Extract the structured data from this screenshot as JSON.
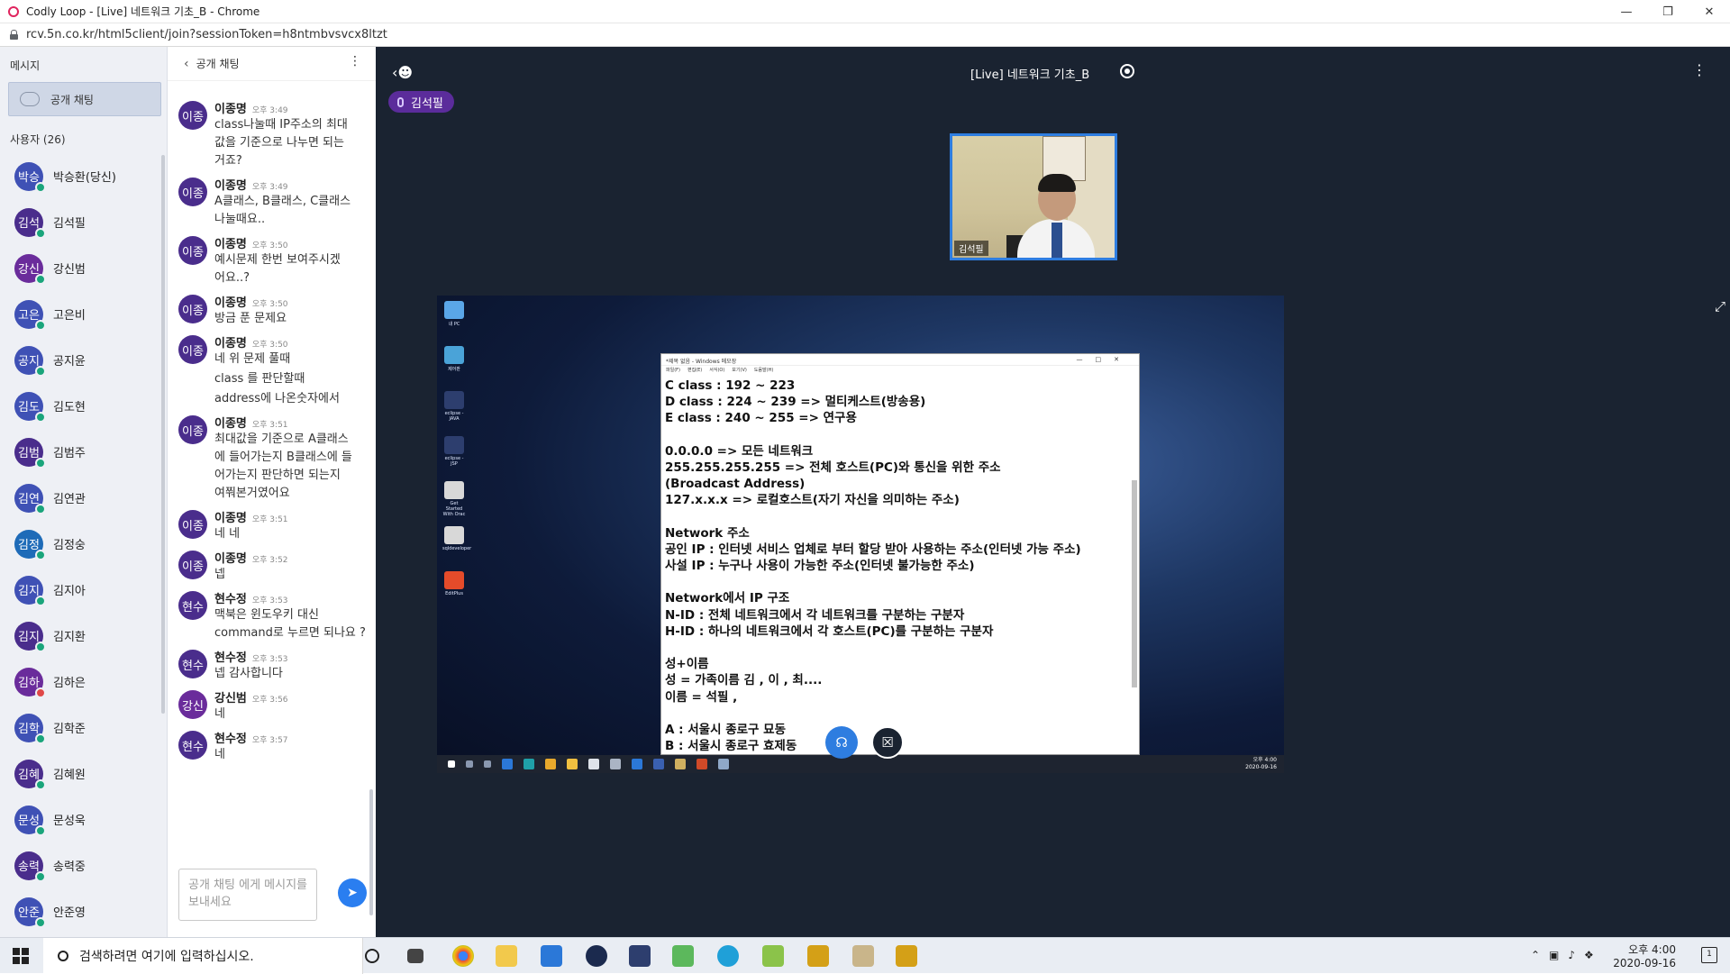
{
  "browser": {
    "title": "Codly Loop - [Live] 네트워크 기초_B - Chrome",
    "url": "rcv.5n.co.kr/html5client/join?sessionToken=h8ntmbvsvcx8ltzt"
  },
  "sidebar": {
    "messages_header": "메시지",
    "public_chat_label": "공개 채팅",
    "users_header": "사용자 (26)",
    "users": [
      {
        "initials": "박승",
        "name": "박승환(당신)",
        "color": "#3f51b5",
        "status": "ok"
      },
      {
        "initials": "김석",
        "name": "김석필",
        "color": "#4a2d8c",
        "status": "ok"
      },
      {
        "initials": "강신",
        "name": "강신범",
        "color": "#6a2c9b",
        "status": "ok"
      },
      {
        "initials": "고은",
        "name": "고은비",
        "color": "#3f51b5",
        "status": "ok"
      },
      {
        "initials": "공지",
        "name": "공지윤",
        "color": "#3f51b5",
        "status": "ok"
      },
      {
        "initials": "김도",
        "name": "김도현",
        "color": "#3f51b5",
        "status": "ok"
      },
      {
        "initials": "김범",
        "name": "김범주",
        "color": "#4a2d8c",
        "status": "ok"
      },
      {
        "initials": "김연",
        "name": "김연관",
        "color": "#3f51b5",
        "status": "ok"
      },
      {
        "initials": "김정",
        "name": "김정숭",
        "color": "#1e6bb8",
        "status": "ok"
      },
      {
        "initials": "김지",
        "name": "김지아",
        "color": "#3f51b5",
        "status": "ok"
      },
      {
        "initials": "김지",
        "name": "김지환",
        "color": "#4a2d8c",
        "status": "ok"
      },
      {
        "initials": "김하",
        "name": "김하은",
        "color": "#6a2c9b",
        "status": "muted"
      },
      {
        "initials": "김학",
        "name": "김학준",
        "color": "#3f51b5",
        "status": "ok"
      },
      {
        "initials": "김혜",
        "name": "김혜원",
        "color": "#4a2d8c",
        "status": "ok"
      },
      {
        "initials": "문성",
        "name": "문성욱",
        "color": "#3f51b5",
        "status": "ok"
      },
      {
        "initials": "송력",
        "name": "송력중",
        "color": "#4a2d8c",
        "status": "ok"
      },
      {
        "initials": "안준",
        "name": "안준영",
        "color": "#3f51b5",
        "status": "ok"
      }
    ]
  },
  "chat": {
    "title": "공개 채팅",
    "input_placeholder": "공개 채팅 에게 메시지를 보내세요",
    "messages": [
      {
        "initials": "이종",
        "author": "이종명",
        "time": "오후 3:49",
        "lines": [
          "class나눌때 IP주소의 최대",
          "값을 기준으로 나누면 되는",
          "거죠?"
        ]
      },
      {
        "initials": "이종",
        "author": "이종명",
        "time": "오후 3:49",
        "lines": [
          "A클래스, B클래스, C클래스",
          "나눌때요.."
        ]
      },
      {
        "initials": "이종",
        "author": "이종명",
        "time": "오후 3:50",
        "lines": [
          "예시문제 한번 보여주시겠",
          "어요..?"
        ]
      },
      {
        "initials": "이종",
        "author": "이종명",
        "time": "오후 3:50",
        "lines": [
          "방금 푼 문제요"
        ]
      },
      {
        "initials": "이종",
        "author": "이종명",
        "time": "오후 3:50",
        "lines": [
          "네 위 문제 풀때",
          "",
          "class 를 판단할때",
          "",
          "address에 나온숫자에서"
        ]
      },
      {
        "initials": "이종",
        "author": "이종명",
        "time": "오후 3:51",
        "lines": [
          "최대값을 기준으로 A클래스",
          "에 들어가는지 B클래스에 들",
          "어가는지 판단하면 되는지",
          "여쭤본거였어요"
        ]
      },
      {
        "initials": "이종",
        "author": "이종명",
        "time": "오후 3:51",
        "lines": [
          "네 네"
        ]
      },
      {
        "initials": "이종",
        "author": "이종명",
        "time": "오후 3:52",
        "lines": [
          "넵"
        ]
      },
      {
        "initials": "현수",
        "author": "현수정",
        "time": "오후 3:53",
        "lines": [
          "맥북은 윈도우키 대신",
          "command로 누르면 되나요 ?"
        ]
      },
      {
        "initials": "현수",
        "author": "현수정",
        "time": "오후 3:53",
        "lines": [
          "넵 감사합니다"
        ]
      },
      {
        "initials": "강신",
        "author": "강신범",
        "time": "오후 3:56",
        "lines": [
          "네"
        ]
      },
      {
        "initials": "현수",
        "author": "현수정",
        "time": "오후 3:57",
        "lines": [
          "네"
        ]
      }
    ]
  },
  "stage": {
    "title": "[Live] 네트워크 기초_B",
    "speaker": "김석필",
    "presenter_label": "김석필"
  },
  "notepad": {
    "title": "*제목 없음 - Windows 메모장",
    "menu": [
      "파일(F)",
      "편집(E)",
      "서식(O)",
      "보기(V)",
      "도움말(H)"
    ],
    "lines": [
      "C class : 192 ~ 223",
      "D class : 224 ~ 239 => 멀티케스트(방송용)",
      "E class : 240 ~ 255 => 연구용",
      "",
      "0.0.0.0 => 모든 네트워크",
      "255.255.255.255 => 전체 호스트(PC)와 통신을 위한 주소",
      "(Broadcast Address)",
      "127.x.x.x => 로컬호스트(자기 자신을 의미하는 주소)",
      "",
      "Network 주소",
      "공인 IP : 인터넷 서비스 업체로 부터 할당 받아 사용하는 주소(인터넷 가능 주소)",
      "사설 IP : 누구나 사용이 가능한 주소(인터넷 불가능한 주소)",
      "",
      "Network에서 IP 구조",
      "N-ID : 전체 네트워크에서 각 네트워크를 구분하는 구분자",
      "H-ID : 하나의 네트워크에서 각 호스트(PC)를 구분하는 구분자",
      "",
      "성+이름",
      "성 = 가족이름 김 , 이 , 최....",
      "이름 = 석필 ,",
      "",
      "A : 서울시 종로구 묘동",
      "B : 서울시 종로구 효제동"
    ]
  },
  "desktop": {
    "icons": [
      "내 PC",
      "제어판",
      "eclipse - JAVA",
      "eclipse - JSP",
      "Get Started With Orac",
      "sqldeveloper",
      "EditPlus"
    ],
    "clock_time": "오후 4:00",
    "clock_date": "2020-09-16"
  },
  "windows_taskbar": {
    "search_placeholder": "검색하려면 여기에 입력하십시오.",
    "time": "오후 4:00",
    "date": "2020-09-16",
    "notification_count": "1"
  }
}
